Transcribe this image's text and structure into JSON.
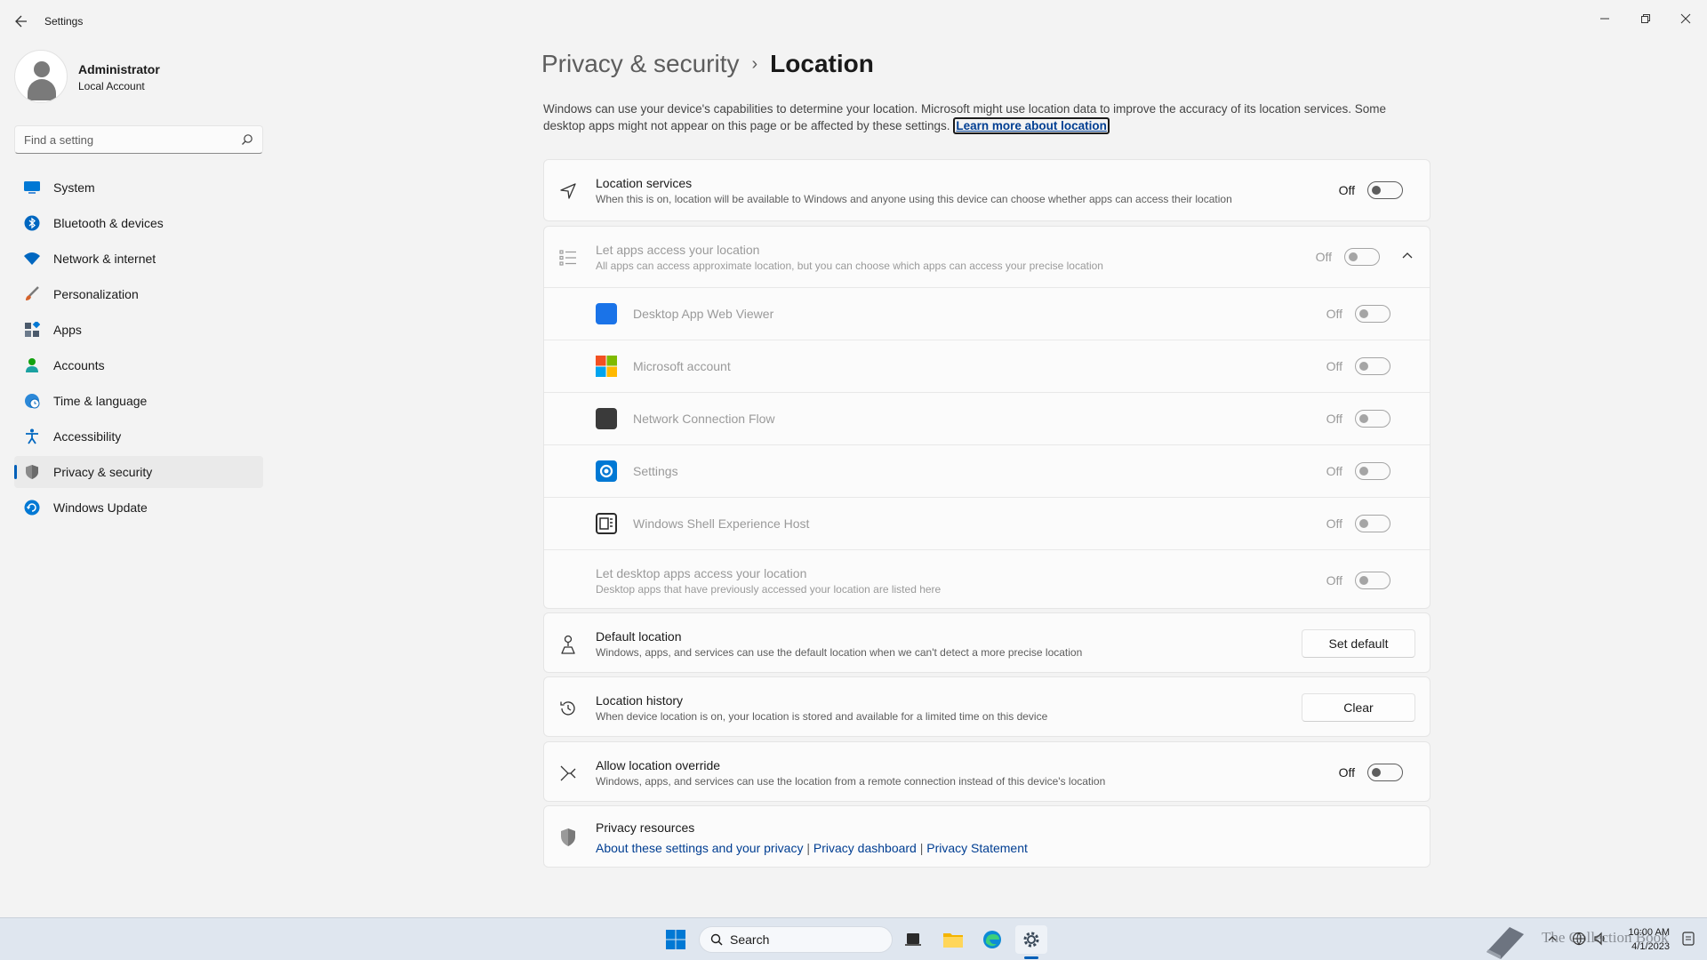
{
  "window": {
    "title": "Settings",
    "controls": {
      "minimize": "─",
      "maximize": "❐",
      "close": "✕"
    }
  },
  "profile": {
    "name": "Administrator",
    "account_type": "Local Account"
  },
  "search": {
    "placeholder": "Find a setting"
  },
  "sidebar": {
    "items": [
      {
        "label": "System",
        "icon": "system-icon",
        "color": "#0078d4"
      },
      {
        "label": "Bluetooth & devices",
        "icon": "bluetooth-icon",
        "color": "#0067c0"
      },
      {
        "label": "Network & internet",
        "icon": "wifi-icon",
        "color": "#0067c0"
      },
      {
        "label": "Personalization",
        "icon": "brush-icon",
        "color": "#d5622b"
      },
      {
        "label": "Apps",
        "icon": "apps-icon",
        "color": "#4b5a6b"
      },
      {
        "label": "Accounts",
        "icon": "accounts-icon",
        "color": "#13a10e"
      },
      {
        "label": "Time & language",
        "icon": "globe-clock-icon",
        "color": "#0078d4"
      },
      {
        "label": "Accessibility",
        "icon": "accessibility-icon",
        "color": "#0067c0"
      },
      {
        "label": "Privacy & security",
        "icon": "shield-icon",
        "color": "#6b6b6b",
        "active": true
      },
      {
        "label": "Windows Update",
        "icon": "update-icon",
        "color": "#0078d4"
      }
    ]
  },
  "page": {
    "breadcrumb_parent": "Privacy & security",
    "breadcrumb_separator": "›",
    "title": "Location",
    "intro": "Windows can use your device's capabilities to determine your location. Microsoft might use location data to improve the accuracy of its location services. Some desktop apps might not appear on this page or be affected by these settings.",
    "learn_more": "Learn more about location"
  },
  "location_services": {
    "title": "Location services",
    "description": "When this is on, location will be available to Windows and anyone using this device can choose whether apps can access their location",
    "state": "Off"
  },
  "apps_access": {
    "title": "Let apps access your location",
    "description": "All apps can access approximate location, but you can choose which apps can access your precise location",
    "state": "Off",
    "apps": [
      {
        "name": "Desktop App Web Viewer",
        "state": "Off",
        "icon_color": "#1a73e8"
      },
      {
        "name": "Microsoft account",
        "state": "Off",
        "icon_color": "#f25022"
      },
      {
        "name": "Network Connection Flow",
        "state": "Off",
        "icon_color": "#3a3a3a"
      },
      {
        "name": "Settings",
        "state": "Off",
        "icon_color": "#0078d4"
      },
      {
        "name": "Windows Shell Experience Host",
        "state": "Off",
        "icon_color": "#2b2b2b"
      }
    ],
    "desktop_apps": {
      "title": "Let desktop apps access your location",
      "description": "Desktop apps that have previously accessed your location are listed here",
      "state": "Off"
    }
  },
  "default_location": {
    "title": "Default location",
    "description": "Windows, apps, and services can use the default location when we can't detect a more precise location",
    "button": "Set default"
  },
  "location_history": {
    "title": "Location history",
    "description": "When device location is on, your location is stored and available for a limited time on this device",
    "button": "Clear"
  },
  "location_override": {
    "title": "Allow location override",
    "description": "Windows, apps, and services can use the location from a remote connection instead of this device's location",
    "state": "Off"
  },
  "privacy_resources": {
    "title": "Privacy resources",
    "link1": "About these settings and your privacy",
    "sep": "|",
    "link2": "Privacy dashboard",
    "link3": "Privacy Statement"
  },
  "taskbar": {
    "search_label": "Search",
    "time": "10:00 AM",
    "date": "4/1/2023",
    "watermark": "The Collection Book"
  },
  "colors": {
    "accent": "#005fb8",
    "link": "#003e92"
  }
}
